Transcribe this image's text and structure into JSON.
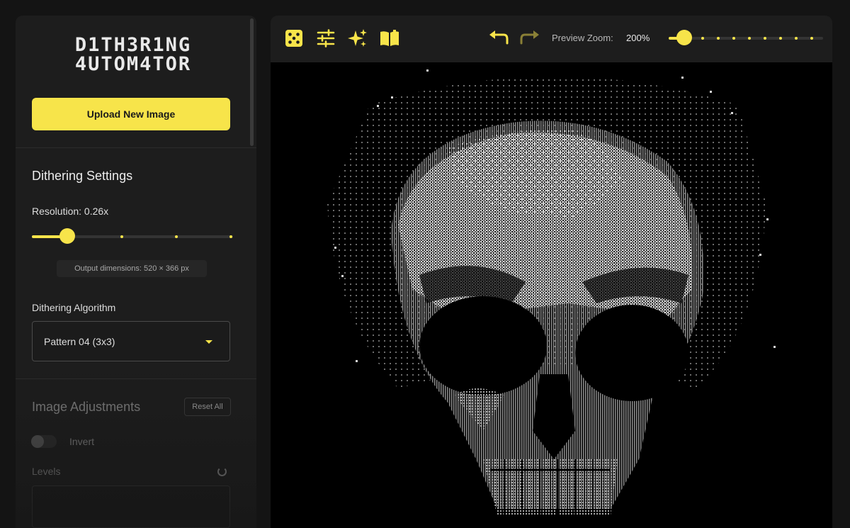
{
  "app": {
    "logo_line1": "D1TH3R1NG",
    "logo_line2": "4UTOM4TOR"
  },
  "sidebar": {
    "upload_button": "Upload New Image",
    "dithering_settings": {
      "title": "Dithering Settings",
      "resolution_label": "Resolution: 0.26x",
      "resolution_value": 0.26,
      "output_dimensions": "Output dimensions: 520 × 366 px",
      "algorithm_label": "Dithering Algorithm",
      "algorithm_selected": "Pattern 04 (3x3)"
    },
    "image_adjustments": {
      "title": "Image Adjustments",
      "reset_all": "Reset All",
      "invert_label": "Invert",
      "invert_on": false,
      "levels_label": "Levels"
    }
  },
  "toolbar": {
    "icons": [
      "dice-icon",
      "sliders-icon",
      "sparkles-icon",
      "book-icon",
      "undo-icon",
      "redo-icon"
    ],
    "zoom_label": "Preview Zoom:",
    "zoom_value": "200%"
  },
  "colors": {
    "accent": "#f7e44a",
    "panel": "#1d1d1d",
    "background": "#141414",
    "preview": "#000000"
  }
}
